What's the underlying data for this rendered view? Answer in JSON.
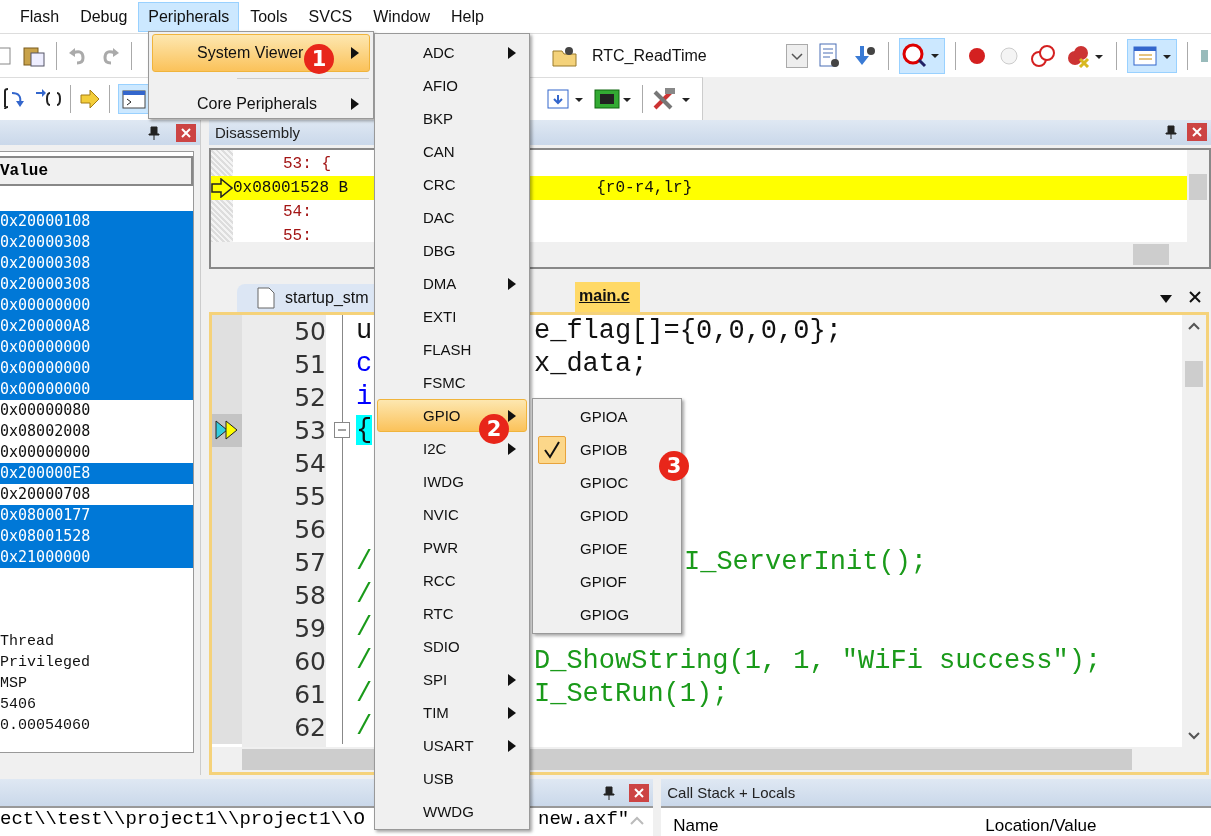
{
  "menu_bar": [
    {
      "label": "Flash",
      "selected": false
    },
    {
      "label": "Debug",
      "selected": false
    },
    {
      "label": "Peripherals",
      "selected": true
    },
    {
      "label": "Tools",
      "selected": false
    },
    {
      "label": "SVCS",
      "selected": false
    },
    {
      "label": "Window",
      "selected": false
    },
    {
      "label": "Help",
      "selected": false
    }
  ],
  "toolbar": {
    "function_combo": "RTC_ReadTime"
  },
  "peripherals_menu": [
    {
      "label": "System Viewer",
      "selected": true,
      "submenu": true,
      "badge": "1"
    },
    {
      "label": "Core Peripherals",
      "selected": false,
      "submenu": true
    }
  ],
  "system_viewer_menu": [
    {
      "label": "ADC",
      "selected": false,
      "submenu": true
    },
    {
      "label": "AFIO",
      "selected": false,
      "submenu": false
    },
    {
      "label": "BKP",
      "selected": false,
      "submenu": false
    },
    {
      "label": "CAN",
      "selected": false,
      "submenu": false
    },
    {
      "label": "CRC",
      "selected": false,
      "submenu": false
    },
    {
      "label": "DAC",
      "selected": false,
      "submenu": false
    },
    {
      "label": "DBG",
      "selected": false,
      "submenu": false
    },
    {
      "label": "DMA",
      "selected": false,
      "submenu": true
    },
    {
      "label": "EXTI",
      "selected": false,
      "submenu": false
    },
    {
      "label": "FLASH",
      "selected": false,
      "submenu": false
    },
    {
      "label": "FSMC",
      "selected": false,
      "submenu": false
    },
    {
      "label": "GPIO",
      "selected": true,
      "submenu": true,
      "badge": "2"
    },
    {
      "label": "I2C",
      "selected": false,
      "submenu": true
    },
    {
      "label": "IWDG",
      "selected": false,
      "submenu": false
    },
    {
      "label": "NVIC",
      "selected": false,
      "submenu": false
    },
    {
      "label": "PWR",
      "selected": false,
      "submenu": false
    },
    {
      "label": "RCC",
      "selected": false,
      "submenu": false
    },
    {
      "label": "RTC",
      "selected": false,
      "submenu": false
    },
    {
      "label": "SDIO",
      "selected": false,
      "submenu": false
    },
    {
      "label": "SPI",
      "selected": false,
      "submenu": true
    },
    {
      "label": "TIM",
      "selected": false,
      "submenu": true
    },
    {
      "label": "USART",
      "selected": false,
      "submenu": true
    },
    {
      "label": "USB",
      "selected": false,
      "submenu": false
    },
    {
      "label": "WWDG",
      "selected": false,
      "submenu": false
    }
  ],
  "gpio_menu": {
    "badge": "3",
    "items": [
      {
        "label": "GPIOA",
        "checked": false
      },
      {
        "label": "GPIOB",
        "checked": true
      },
      {
        "label": "GPIOC",
        "checked": false
      },
      {
        "label": "GPIOD",
        "checked": false
      },
      {
        "label": "GPIOE",
        "checked": false
      },
      {
        "label": "GPIOF",
        "checked": false
      },
      {
        "label": "GPIOG",
        "checked": false
      }
    ]
  },
  "registers_panel": {
    "column": "Value",
    "rows": [
      {
        "value": "0x20000108",
        "selected": true
      },
      {
        "value": "0x20000308",
        "selected": true
      },
      {
        "value": "0x20000308",
        "selected": true
      },
      {
        "value": "0x20000308",
        "selected": true
      },
      {
        "value": "0x00000000",
        "selected": true
      },
      {
        "value": "0x200000A8",
        "selected": true
      },
      {
        "value": "0x00000000",
        "selected": true
      },
      {
        "value": "0x00000000",
        "selected": true
      },
      {
        "value": "0x00000000",
        "selected": true
      },
      {
        "value": "0x00000080",
        "selected": false
      },
      {
        "value": "0x08002008",
        "selected": false
      },
      {
        "value": "0x00000000",
        "selected": false
      },
      {
        "value": "0x200000E8",
        "selected": true
      },
      {
        "value": "0x20000708",
        "selected": false
      },
      {
        "value": "0x08000177",
        "selected": true
      },
      {
        "value": "0x08001528",
        "selected": true
      },
      {
        "value": "0x21000000",
        "selected": true
      }
    ],
    "state_rows": [
      "Thread",
      "Privileged",
      "MSP",
      "5406",
      "0.00054060"
    ]
  },
  "disassembly": {
    "title": "Disassembly",
    "lines": [
      {
        "kind": "source",
        "text": "53: {"
      },
      {
        "kind": "current",
        "text": "0x08001528 B",
        "operands": "{r0-r4,lr}"
      },
      {
        "kind": "source",
        "text": "54:"
      },
      {
        "kind": "source",
        "text": "55:"
      }
    ]
  },
  "editor": {
    "tabs": [
      {
        "label": "startup_stm",
        "selected": false
      },
      {
        "label": "main.c",
        "selected": true
      }
    ],
    "lines": [
      {
        "number": "50",
        "left": {
          "text": "u",
          "kind": "plain"
        },
        "right": {
          "text": "e_flag[]={0,0,0,0};",
          "kind": "plain"
        },
        "current": false
      },
      {
        "number": "51",
        "left": {
          "text": "c",
          "kind": "keyword"
        },
        "right": {
          "text": "x_data;",
          "kind": "plain"
        },
        "current": false
      },
      {
        "number": "52",
        "left": {
          "text": "i",
          "kind": "keyword"
        },
        "current": false
      },
      {
        "number": "53",
        "left": {
          "text": "{",
          "kind": "plain"
        },
        "current": true
      },
      {
        "number": "54",
        "current": false
      },
      {
        "number": "55",
        "current": false
      },
      {
        "number": "56",
        "current": false
      },
      {
        "number": "57",
        "left": {
          "text": "/",
          "kind": "comment"
        },
        "right": {
          "text": "I_ServerInit();",
          "kind": "comment"
        },
        "current": false
      },
      {
        "number": "58",
        "left": {
          "text": "/",
          "kind": "comment"
        },
        "current": false
      },
      {
        "number": "59",
        "left": {
          "text": "/",
          "kind": "comment"
        },
        "current": false
      },
      {
        "number": "60",
        "left": {
          "text": "/",
          "kind": "comment"
        },
        "right": {
          "text": "D_ShowString(1, 1, \"WiFi success\");",
          "kind": "comment"
        },
        "current": false
      },
      {
        "number": "61",
        "left": {
          "text": "/",
          "kind": "comment"
        },
        "right": {
          "text": "I_SetRun(1);",
          "kind": "comment"
        },
        "current": false
      },
      {
        "number": "62",
        "left": {
          "text": "/",
          "kind": "comment"
        },
        "current": false
      }
    ]
  },
  "command_panel": {
    "text_left": "ect\\\\test\\\\project1\\\\project1\\\\O",
    "text_right": "new.axf\""
  },
  "call_stack": {
    "title": "Call Stack + Locals",
    "columns": [
      "Name",
      "Location/Value"
    ]
  }
}
